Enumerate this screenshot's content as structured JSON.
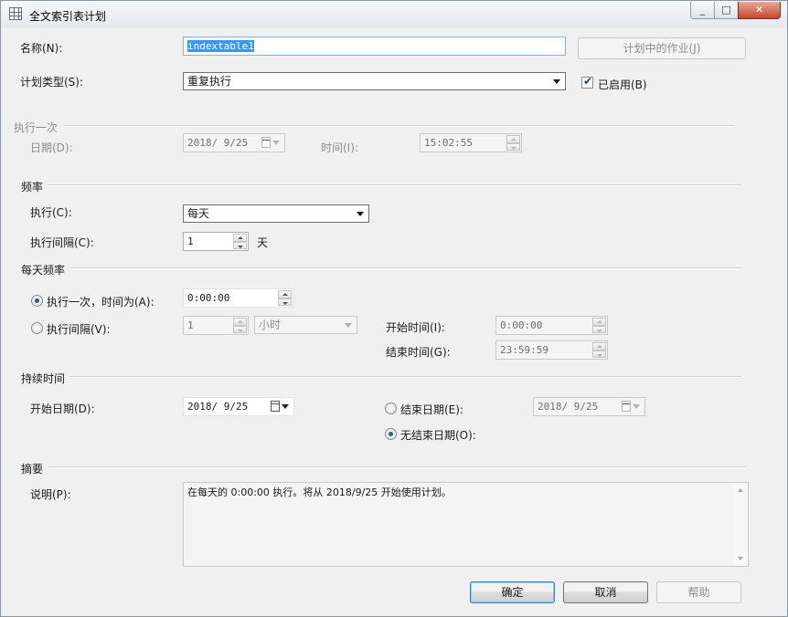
{
  "window": {
    "title": "全文索引表计划",
    "minimize": "_",
    "maximize": "□",
    "close": "✕"
  },
  "name": {
    "label": "名称(N):",
    "value": "indextable1"
  },
  "jobs_button": "计划中的作业(J)",
  "schedule_type": {
    "label": "计划类型(S):",
    "value": "重复执行",
    "enabled_label": "已启用(B)",
    "enabled_checked": true
  },
  "one_time": {
    "section": "执行一次",
    "date_label": "日期(D):",
    "date_value": "2018/ 9/25",
    "time_label": "时间(I):",
    "time_value": "15:02:55"
  },
  "frequency": {
    "section": "频率",
    "occurs_label": "执行(C):",
    "occurs_value": "每天",
    "interval_label": "执行间隔(C):",
    "interval_value": "1",
    "interval_unit": "天"
  },
  "daily_frequency": {
    "section": "每天频率",
    "once_label": "执行一次，时间为(A):",
    "once_value": "0:00:00",
    "once_selected": true,
    "every_label": "执行间隔(V):",
    "every_value": "1",
    "every_unit": "小时",
    "start_label": "开始时间(I):",
    "start_value": "0:00:00",
    "end_label": "结束时间(G):",
    "end_value": "23:59:59"
  },
  "duration": {
    "section": "持续时间",
    "start_date_label": "开始日期(D):",
    "start_date_value": "2018/ 9/25",
    "end_date_label": "结束日期(E):",
    "end_date_value": "2018/ 9/25",
    "no_end_label": "无结束日期(O):",
    "no_end_selected": true
  },
  "summary": {
    "section": "摘要",
    "desc_label": "说明(P):",
    "desc_value": "在每天的 0:00:00 执行。将从 2018/9/25 开始使用计划。"
  },
  "buttons": {
    "ok": "确定",
    "cancel": "取消",
    "help": "帮助"
  }
}
